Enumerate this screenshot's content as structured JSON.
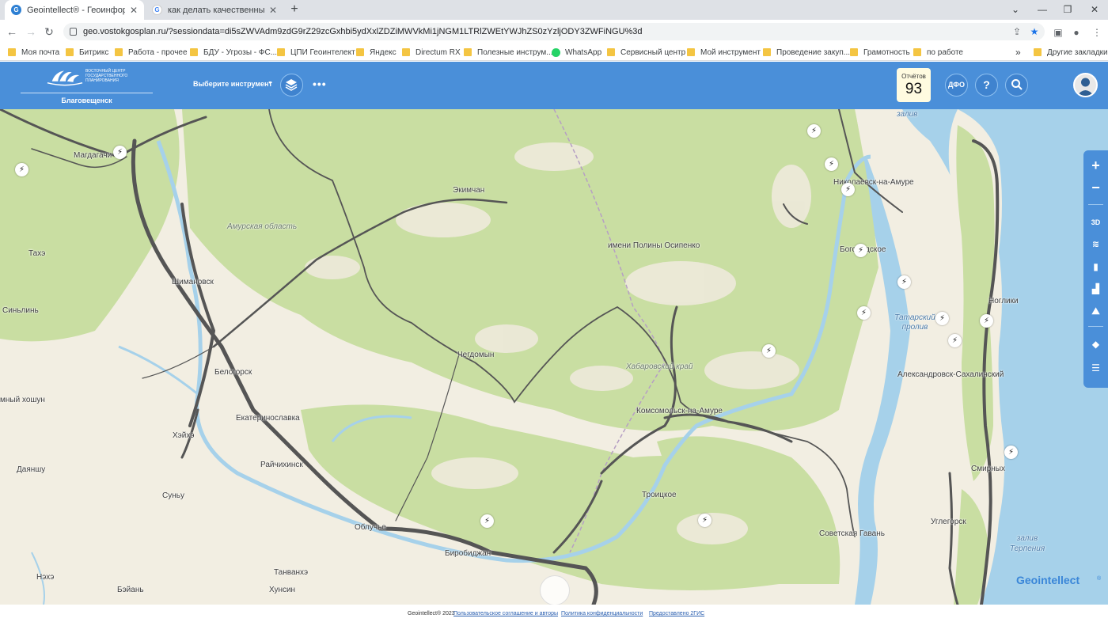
{
  "browser": {
    "tabs": [
      {
        "title": "Geointellect® - Геоинформаци",
        "active": true
      },
      {
        "title": "как делать качественные снимк",
        "active": false
      }
    ],
    "url": "geo.vostokgosplan.ru/?sessiondata=di5sZWVAdm9zdG9rZ29zcGxhbi5ydXxlZDZiMWVkMi1jNGM1LTRlZWEtYWJhZS0zYzljODY3ZWFiNGU%3d",
    "bookmarks": [
      "Моя почта",
      "Битрикс",
      "Работа - прочее",
      "БДУ - Угрозы - ФС...",
      "ЦПИ Геоинтелект",
      "Яндекс",
      "Directum RX",
      "Полезные инструм...",
      "WhatsApp",
      "Сервисный центр",
      "Мой инструмент",
      "Проведение закуп...",
      "Грамотность",
      "по работе"
    ],
    "bookmarks_more": "»",
    "other_bookmarks": "Другие закладки"
  },
  "header": {
    "org_name": "ВОСТОЧНЫЙ ЦЕНТР ГОСУДАРСТВЕННОГО ПЛАНИРОВАНИЯ",
    "city": "Благовещенск",
    "tool_select": "Выберите инструмент",
    "more": "•••",
    "reports_label": "Отчётов",
    "reports_count": "93",
    "region_button": "ДФО",
    "help_button": "?"
  },
  "map": {
    "labels": {
      "zaliv_top": "залив",
      "magdagachi": "Магдагачи",
      "ekimchan": "Экимчан",
      "amur_oblast": "Амурская область",
      "nikolaevsk": "Николаевск-на-Амуре",
      "taxe": "Тахэ",
      "polina": "имени Полины Осипенко",
      "bogorodskoe": "Богородское",
      "shimanovsk": "Шимановск",
      "sinlin": "Синьлинь",
      "nogliki": "Ноглики",
      "tatar_strait": "Татарский пролив",
      "chegdomyn": "Чегдомын",
      "khabarovsk_krai": "Хабаровский край",
      "alexandrovsk": "Александровск-Сахалинский",
      "belogorsk": "Белогорск",
      "khoshun": "мный хошун",
      "komsomolsk": "Комсомольск-на-Амуре",
      "ekaterinoslavka": "Екатеринославка",
      "heihe": "Хэйхэ",
      "raichikhinsk": "Райчихинск",
      "dayanshu": "Даяншу",
      "smirnykh": "Смирных",
      "sunu": "Суньу",
      "troitskoe": "Троицкое",
      "obluchye": "Облучье",
      "uglegorsk": "Углегорск",
      "sovgavan": "Советская Гавань",
      "zaliv_terpeniya": "залив Терпения",
      "birobidzhan": "Биробиджан",
      "nehe": "Нэхэ",
      "tanvanhe": "Танванхэ",
      "beian": "Бэйань",
      "hunsin": "Хунсин"
    },
    "sidebar": {
      "zoom_in": "+",
      "zoom_out": "−",
      "mode_3d": "3D"
    },
    "watermark": "Geointellect",
    "watermark_reg": "®"
  },
  "footer": {
    "copyright": "Geointellect® 2023",
    "link_agreement": "Пользовательское соглашение и авторы",
    "link_privacy": "Политика конфиденциальности",
    "link_2gis": "Предоставлено 2ГИС"
  },
  "colors": {
    "brand_blue": "#4a8fd9",
    "forest": "#c9dea2",
    "water": "#a6d1ea",
    "route": "#555555"
  }
}
